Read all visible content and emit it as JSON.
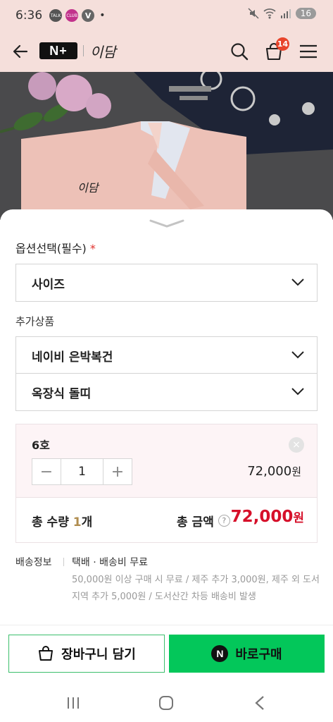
{
  "status_bar": {
    "time": "6:36",
    "app_icon_1": "TALK",
    "app_icon_2": "CLUB",
    "app_icon_3": "V",
    "battery": "16",
    "icons": [
      "mute-icon",
      "wifi-icon",
      "signal-icon",
      "battery-icon"
    ]
  },
  "header": {
    "brand_badge": "N+",
    "store_logo": "이담",
    "cart_count": "14",
    "icons": [
      "back-icon",
      "search-icon",
      "cart-icon",
      "menu-icon"
    ]
  },
  "photo": {
    "label_logo": "이담"
  },
  "sheet": {
    "option_label": "옵션선택(필수)",
    "required_mark": "*",
    "size_select": "사이즈",
    "addon_label": "추가상품",
    "addon_1": "네이비 은박복건",
    "addon_2": "옥장식 돌띠"
  },
  "summary": {
    "option_name": "6호",
    "remove": "×",
    "minus": "−",
    "quantity": "1",
    "plus": "+",
    "line_price": "72,000",
    "line_price_unit": "원",
    "total_qty_label": "총 수량",
    "total_qty_value": "1",
    "total_qty_unit": "개",
    "total_price_label": "총 금액",
    "help": "?",
    "total_price": "72,000",
    "total_price_unit": "원"
  },
  "shipping": {
    "title": "배송정보",
    "main": "택배 · 배송비 무료",
    "sub": "50,000원 이상 구매 시 무료 / 제주 추가 3,000원, 제주 외 도서지역 추가 5,000원 / 도서산간 차등 배송비 발생"
  },
  "actions": {
    "cart_button": "장바구니 담기",
    "buy_button": "바로구매",
    "npay_mark": "N"
  },
  "colors": {
    "header_bg": "#f5dfdb",
    "price_red": "#d6102a",
    "naver_green": "#03c75a",
    "required_red": "#e0312c"
  }
}
